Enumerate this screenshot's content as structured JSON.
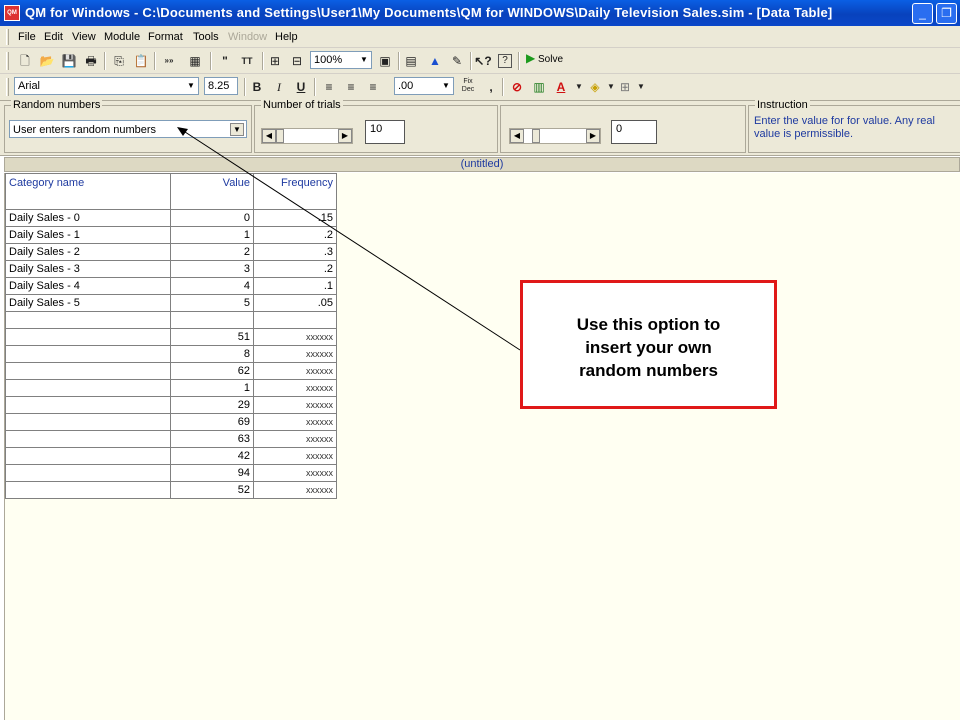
{
  "window": {
    "title": "QM for Windows - C:\\Documents and Settings\\User1\\My Documents\\QM for WINDOWS\\Daily Television Sales.sim - [Data Table]",
    "app_icon_text": "QM"
  },
  "menu": [
    "File",
    "Edit",
    "View",
    "Module",
    "Format",
    "Tools",
    "Window",
    "Help"
  ],
  "toolbar": {
    "zoom": "100%",
    "solve_label": "Solve",
    "font_name": "Arial",
    "font_size": "8.25",
    "bold": "B",
    "italic": "I",
    "underline": "U",
    "decimals": ".00",
    "fix_dec": "Fix Dec",
    "comma": ","
  },
  "options": {
    "random_numbers_label": "Random numbers",
    "random_numbers_value": "User enters random numbers",
    "trials_label": "Number of trials",
    "trials_value": "10",
    "second_value": "0",
    "instruction_label": "Instruction",
    "instruction_text": "Enter the value for  for value. Any real value is permissible."
  },
  "doc_title": "(untitled)",
  "table": {
    "headers": [
      "Category name",
      "Value",
      "Frequency"
    ],
    "rows": [
      [
        "Daily Sales - 0",
        "0",
        ".15"
      ],
      [
        "Daily Sales - 1",
        "1",
        ".2"
      ],
      [
        "Daily Sales - 2",
        "2",
        ".3"
      ],
      [
        "Daily Sales - 3",
        "3",
        ".2"
      ],
      [
        "Daily Sales - 4",
        "4",
        ".1"
      ],
      [
        "Daily Sales - 5",
        "5",
        ".05"
      ],
      [
        "",
        "",
        ""
      ],
      [
        "",
        "51",
        "xxxxxx"
      ],
      [
        "",
        "8",
        "xxxxxx"
      ],
      [
        "",
        "62",
        "xxxxxx"
      ],
      [
        "",
        "1",
        "xxxxxx"
      ],
      [
        "",
        "29",
        "xxxxxx"
      ],
      [
        "",
        "69",
        "xxxxxx"
      ],
      [
        "",
        "63",
        "xxxxxx"
      ],
      [
        "",
        "42",
        "xxxxxx"
      ],
      [
        "",
        "94",
        "xxxxxx"
      ],
      [
        "",
        "52",
        "xxxxxx"
      ]
    ]
  },
  "callout": {
    "lines": [
      "Use this option to",
      "insert your own",
      "random numbers"
    ],
    "border_color": "#e01818"
  }
}
